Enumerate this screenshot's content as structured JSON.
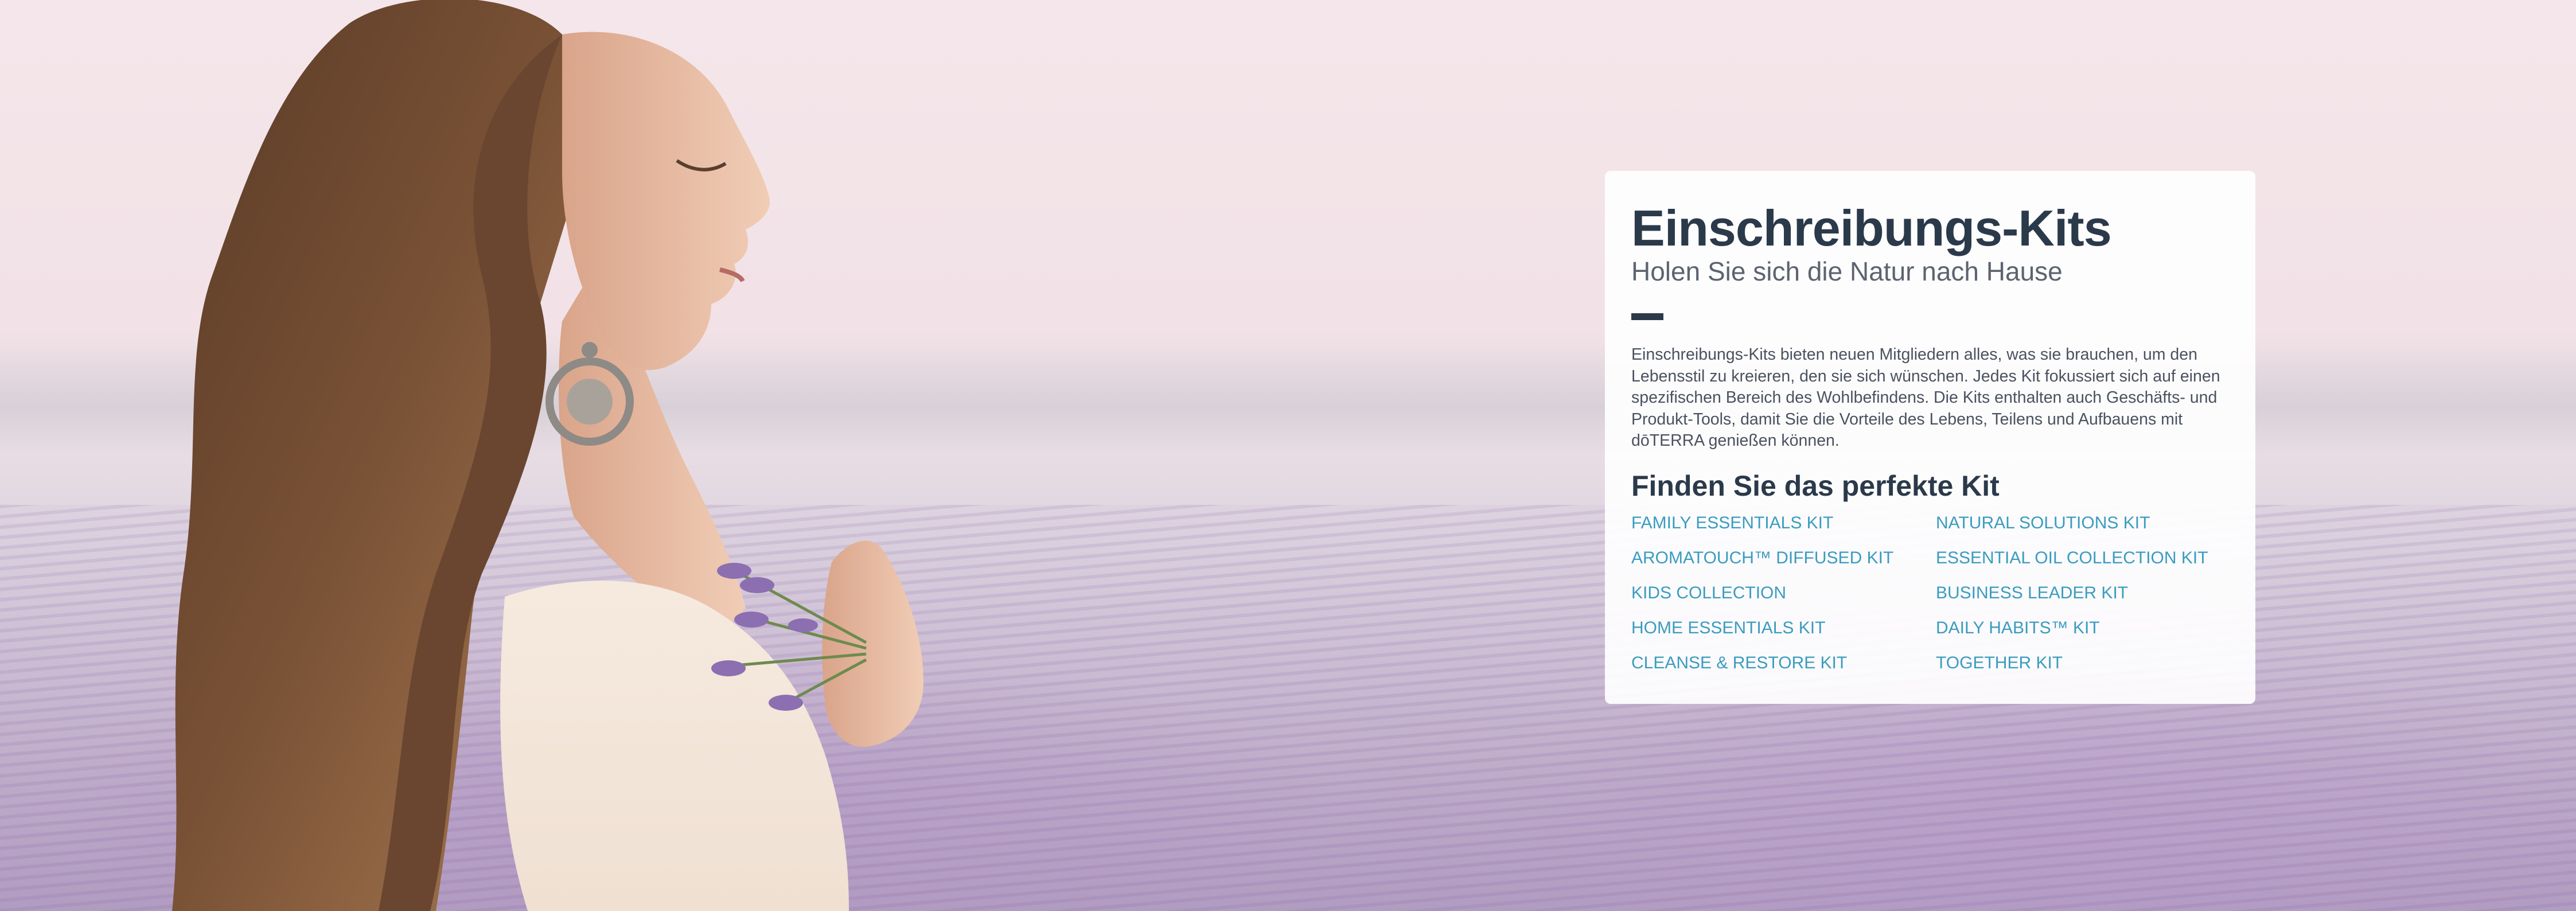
{
  "card": {
    "title": "Einschreibungs-Kits",
    "subtitle": "Holen Sie sich die Natur nach Hause",
    "description": "Einschreibungs-Kits bieten neuen Mitgliedern alles, was sie brauchen, um den Lebensstil zu kreieren, den sie sich wünschen. Jedes Kit fokussiert sich auf einen spezifischen Bereich des Wohlbefindens. Die Kits enthalten auch Geschäfts- und Produkt-Tools, damit Sie die Vorteile des Lebens, Teilens und Aufbauens mit dōTERRA genießen können.",
    "find_heading": "Finden Sie das perfekte Kit",
    "kits": [
      "FAMILY ESSENTIALS KIT",
      "NATURAL SOLUTIONS KIT",
      "AROMATOUCH™ DIFFUSED KIT",
      "ESSENTIAL OIL COLLECTION KIT",
      "KIDS COLLECTION",
      "BUSINESS LEADER KIT",
      "HOME ESSENTIALS KIT",
      "DAILY HABITS™ KIT",
      "CLEANSE & RESTORE KIT",
      "TOGETHER KIT"
    ]
  },
  "colors": {
    "heading": "#2b3a4a",
    "link": "#3a9cbf",
    "card_background": "#ffffff"
  }
}
